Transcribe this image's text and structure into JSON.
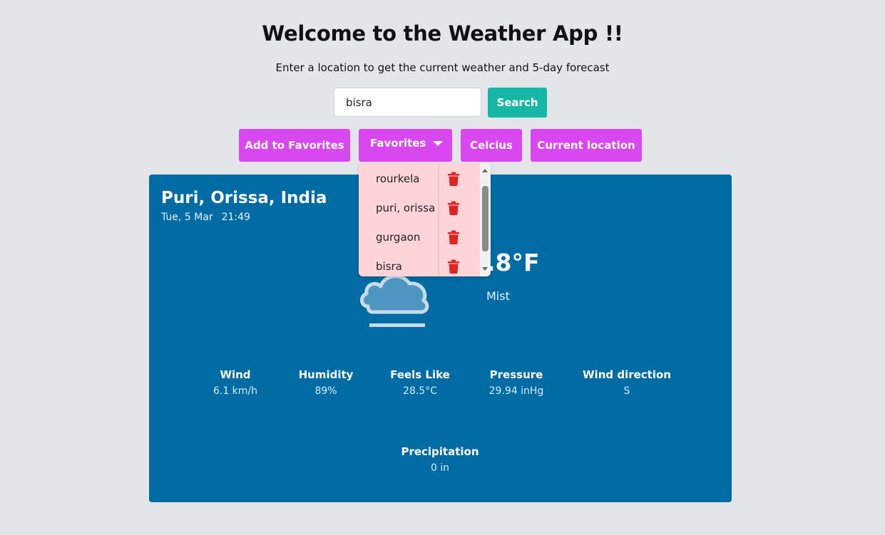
{
  "header": {
    "title": "Welcome to the Weather App !!",
    "subtitle": "Enter a location to get the current weather and 5-day forecast"
  },
  "search": {
    "value": "bisra",
    "button_label": "Search"
  },
  "actions": {
    "add_favorites": "Add to Favorites",
    "favorites": "Favorites",
    "unit_toggle": "Celcius",
    "current_location": "Current location"
  },
  "favorites_list": [
    {
      "name": "rourkela"
    },
    {
      "name": "puri, orissa"
    },
    {
      "name": "gurgaon"
    },
    {
      "name": "bisra"
    }
  ],
  "weather": {
    "city": "Puri, Orissa, India",
    "date": "Tue, 5 Mar",
    "time": "21:49",
    "temperature": ".8°F",
    "condition": "Mist",
    "icon": "mist-cloud-icon",
    "stats": {
      "wind": {
        "label": "Wind",
        "value": "6.1 km/h"
      },
      "humidity": {
        "label": "Humidity",
        "value": "89%"
      },
      "feels_like": {
        "label": "Feels Like",
        "value": "28.5°C"
      },
      "pressure": {
        "label": "Pressure",
        "value": "29.94 inHg"
      },
      "wind_direction": {
        "label": "Wind direction",
        "value": "S"
      },
      "precipitation": {
        "label": "Precipitation",
        "value": "0 in"
      }
    }
  },
  "colors": {
    "background": "#e4e5e9",
    "accent_teal": "#16b8a5",
    "accent_purple": "#d847ef",
    "card_blue": "#016ba3",
    "dropdown_pink": "#ffd4d9",
    "trash_red": "#e02424"
  }
}
